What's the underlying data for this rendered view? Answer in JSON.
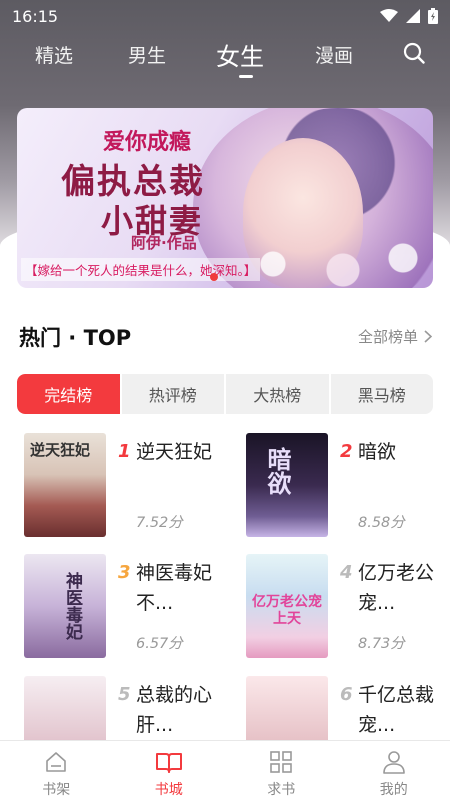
{
  "status": {
    "time": "16:15"
  },
  "top_tabs": [
    {
      "label": "精选"
    },
    {
      "label": "男生"
    },
    {
      "label": "女生"
    },
    {
      "label": "漫画"
    }
  ],
  "banner": {
    "line1": "爱你成瘾",
    "line2": "偏执总裁",
    "line3": "小甜妻",
    "author": "阿伊·作品",
    "tagline": "【嫁给一个死人的结果是什么，她深知。】"
  },
  "hot": {
    "title": "热门 · TOP",
    "more": "全部榜单"
  },
  "segments": [
    {
      "label": "完结榜"
    },
    {
      "label": "热评榜"
    },
    {
      "label": "大热榜"
    },
    {
      "label": "黑马榜"
    }
  ],
  "books": [
    {
      "rank": "1",
      "name": "逆天狂妃",
      "score": "7.52分",
      "rank_color": "#f33a3e"
    },
    {
      "rank": "2",
      "name": "暗欲",
      "score": "8.58分",
      "rank_color": "#f33a3e"
    },
    {
      "rank": "3",
      "name": "神医毒妃不...",
      "score": "6.57分",
      "rank_color": "#f6a63f"
    },
    {
      "rank": "4",
      "name": "亿万老公宠...",
      "score": "8.73分",
      "rank_color": "#bbbbbb"
    },
    {
      "rank": "5",
      "name": "总裁的心肝...",
      "score": "",
      "rank_color": "#bbbbbb"
    },
    {
      "rank": "6",
      "name": "千亿总裁宠...",
      "score": "",
      "rank_color": "#bbbbbb"
    }
  ],
  "covers": [
    {
      "text": "逆天狂妃"
    },
    {
      "text": "暗欲"
    },
    {
      "text": "神医毒妃"
    },
    {
      "text": "亿万老公宠上天"
    },
    {
      "text": ""
    },
    {
      "text": ""
    }
  ],
  "bottom_nav": [
    {
      "label": "书架",
      "icon": "bookshelf-icon"
    },
    {
      "label": "书城",
      "icon": "open-book-icon"
    },
    {
      "label": "求书",
      "icon": "grid-icon"
    },
    {
      "label": "我的",
      "icon": "user-icon"
    }
  ],
  "colors": {
    "accent": "#f33a3e"
  }
}
